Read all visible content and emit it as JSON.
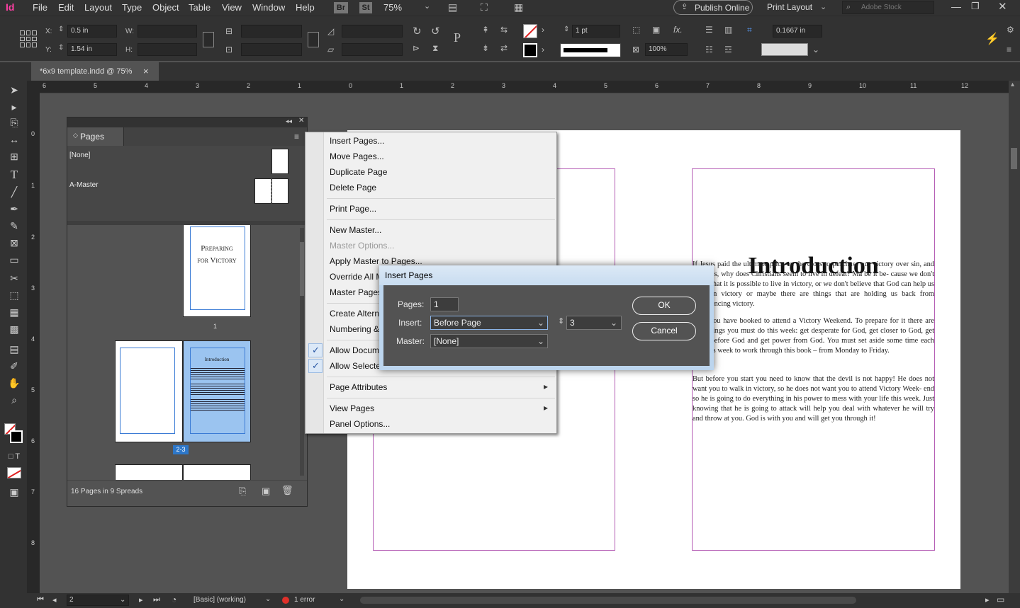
{
  "menubar": {
    "app_logo": "Id",
    "items": [
      "File",
      "Edit",
      "Layout",
      "Type",
      "Object",
      "Table",
      "View",
      "Window",
      "Help"
    ],
    "br_badge": "Br",
    "st_badge": "St",
    "zoom": "75%",
    "publish_online": "Publish Online",
    "workspace": "Print Layout",
    "search_placeholder": "Adobe Stock"
  },
  "control": {
    "x_label": "X:",
    "x_value": "0.5 in",
    "y_label": "Y:",
    "y_value": "1.54 in",
    "w_label": "W:",
    "h_label": "H:",
    "stroke_weight": "1 pt",
    "opacity": "100%",
    "offset": "0.1667 in"
  },
  "doc_tab": {
    "title": "*6x9 template.indd @ 75%",
    "close": "×"
  },
  "ruler": {
    "h_labels": [
      "6",
      "5",
      "4",
      "3",
      "2",
      "1",
      "0",
      "1",
      "2",
      "3",
      "4",
      "5",
      "6",
      "7",
      "8",
      "9",
      "10",
      "11",
      "12"
    ],
    "v_labels": [
      "0",
      "1",
      "2",
      "3",
      "4",
      "5",
      "6",
      "7",
      "8"
    ]
  },
  "pages_panel": {
    "title": "Pages",
    "masters": [
      "[None]",
      "A-Master"
    ],
    "thumb1_text_line1": "Preparing",
    "thumb1_text_line2": "for Victory",
    "page1_label": "1",
    "spread_label": "2-3",
    "thumb3_title": "Introduction",
    "footer": "16 Pages in 9 Spreads"
  },
  "context_menu": {
    "items": [
      {
        "label": "Insert Pages...",
        "disabled": false
      },
      {
        "label": "Move Pages...",
        "disabled": false
      },
      {
        "label": "Duplicate Page",
        "disabled": false
      },
      {
        "label": "Delete Page",
        "disabled": false
      },
      {
        "label": "Print Page...",
        "disabled": false
      },
      {
        "label": "New Master...",
        "disabled": false
      },
      {
        "label": "Master Options...",
        "disabled": true
      },
      {
        "label": "Apply Master to Pages...",
        "disabled": false
      },
      {
        "label": "Override All M",
        "disabled": false
      },
      {
        "label": "Master Pages",
        "disabled": false
      },
      {
        "label": "Create Altern",
        "disabled": false
      },
      {
        "label": "Numbering &",
        "disabled": false
      },
      {
        "label": "Allow Docum",
        "disabled": false
      },
      {
        "label": "Allow Selecte",
        "disabled": false
      },
      {
        "label": "Page Attributes",
        "disabled": false
      },
      {
        "label": "View Pages",
        "disabled": false
      },
      {
        "label": "Panel Options...",
        "disabled": false
      }
    ],
    "check": "✓",
    "arrow": "▸"
  },
  "dialog": {
    "title": "Insert Pages",
    "pages_label": "Pages:",
    "pages_value": "1",
    "insert_label": "Insert:",
    "insert_value": "Before Page",
    "page_number": "3",
    "master_label": "Master:",
    "master_value": "[None]",
    "ok": "OK",
    "cancel": "Cancel"
  },
  "document": {
    "title": "Introduction",
    "para1": "If Jesus paid the ultimate price on the cross to purchase our victory over sin, and sickness, why does Christians seem to live in defeat? Ma be it be- cause we don't know that it is possible to live in victory, or we don't believe that God can help us walk in victory or maybe there are things that are holding us back from experiencing victory.",
    "para2": "Why you have booked to attend a Victory Weekend. To prepare for it there are four things you must do this week: get desperate for God, get closer to God, get clean before God and get power from God. You must set aside some time each day this week to work through this book – from Monday to Friday.",
    "para3": "But before you start you need to know that the devil is not happy! He does not want you to walk in victory, so he does not want you to attend Victory Week- end so he is going to do everything in his power to mess with your life this week. Just knowing that he is going to attack will help you deal with whatever he will try and throw at you. God is with you and will get you through it!"
  },
  "status": {
    "page": "2",
    "style": "[Basic] (working)",
    "errors": "1 error"
  }
}
